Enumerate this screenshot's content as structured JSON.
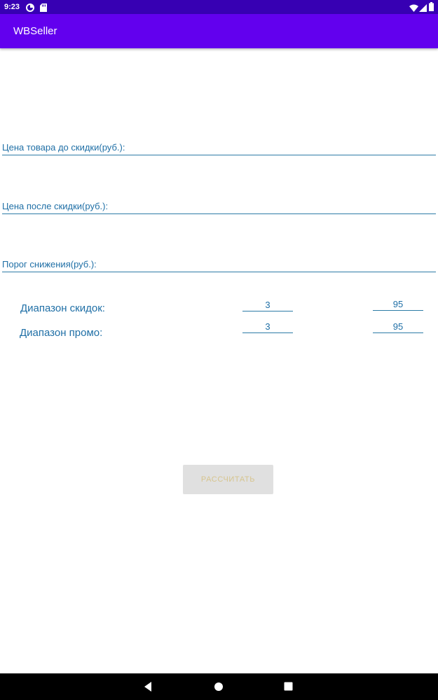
{
  "status_bar": {
    "time": "9:23",
    "left_icons": [
      "data-saver-icon",
      "sd-card-icon"
    ],
    "right_icons": [
      "wifi-icon",
      "cellular-signal-icon",
      "battery-icon"
    ]
  },
  "app_bar": {
    "title": "WBSeller"
  },
  "form": {
    "price_before_label": "Цена товара до скидки(руб.):",
    "price_after_label": "Цена после скидки(руб.):",
    "threshold_label": "Порог снижения(руб.):",
    "discount_range": {
      "label": "Диапазон скидок:",
      "min": "3",
      "max": "95"
    },
    "promo_range": {
      "label": "Диапазон промо:",
      "min": "3",
      "max": "95"
    },
    "calculate_label": "РАССЧИТАТЬ"
  },
  "nav_bar": {
    "icons": [
      "back-icon",
      "home-icon",
      "recents-icon"
    ]
  },
  "colors": {
    "status_bar": "#3700b3",
    "app_bar": "#6200ee",
    "field_text": "#1f6fa6",
    "button_bg": "#e0e0e0",
    "button_text": "#d6c48e"
  }
}
